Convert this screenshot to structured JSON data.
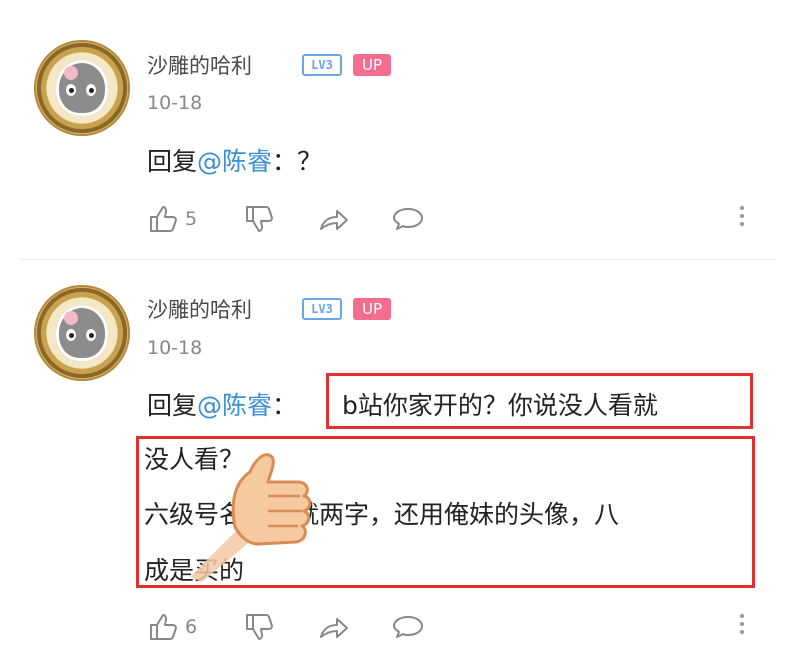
{
  "comments": [
    {
      "username": "沙雕的哈利",
      "level_badge": "LV3",
      "up_badge": "UP",
      "date": "10-18",
      "reply_prefix": "回复",
      "mention": "@陈睿",
      "reply_text": "：？",
      "likes": "5"
    },
    {
      "username": "沙雕的哈利",
      "level_badge": "LV3",
      "up_badge": "UP",
      "date": "10-18",
      "reply_prefix": "回复",
      "mention": "@陈睿",
      "colon": "：",
      "highlight_text": "b站你家开的？你说没人看就",
      "line2": "没人看？",
      "line3": "六级号名字还就两字，还用俺妹的头像，八",
      "line4": "成是买的",
      "likes": "6"
    }
  ],
  "icons": [
    "like-icon",
    "dislike-icon",
    "share-icon",
    "comment-icon",
    "more-icon",
    "thumbs-up-sticker"
  ],
  "colors": {
    "mention": "#3a8fd6",
    "up_badge": "#f26d8e",
    "level_badge": "#6aa5e6",
    "highlight_box": "#e0302f"
  }
}
